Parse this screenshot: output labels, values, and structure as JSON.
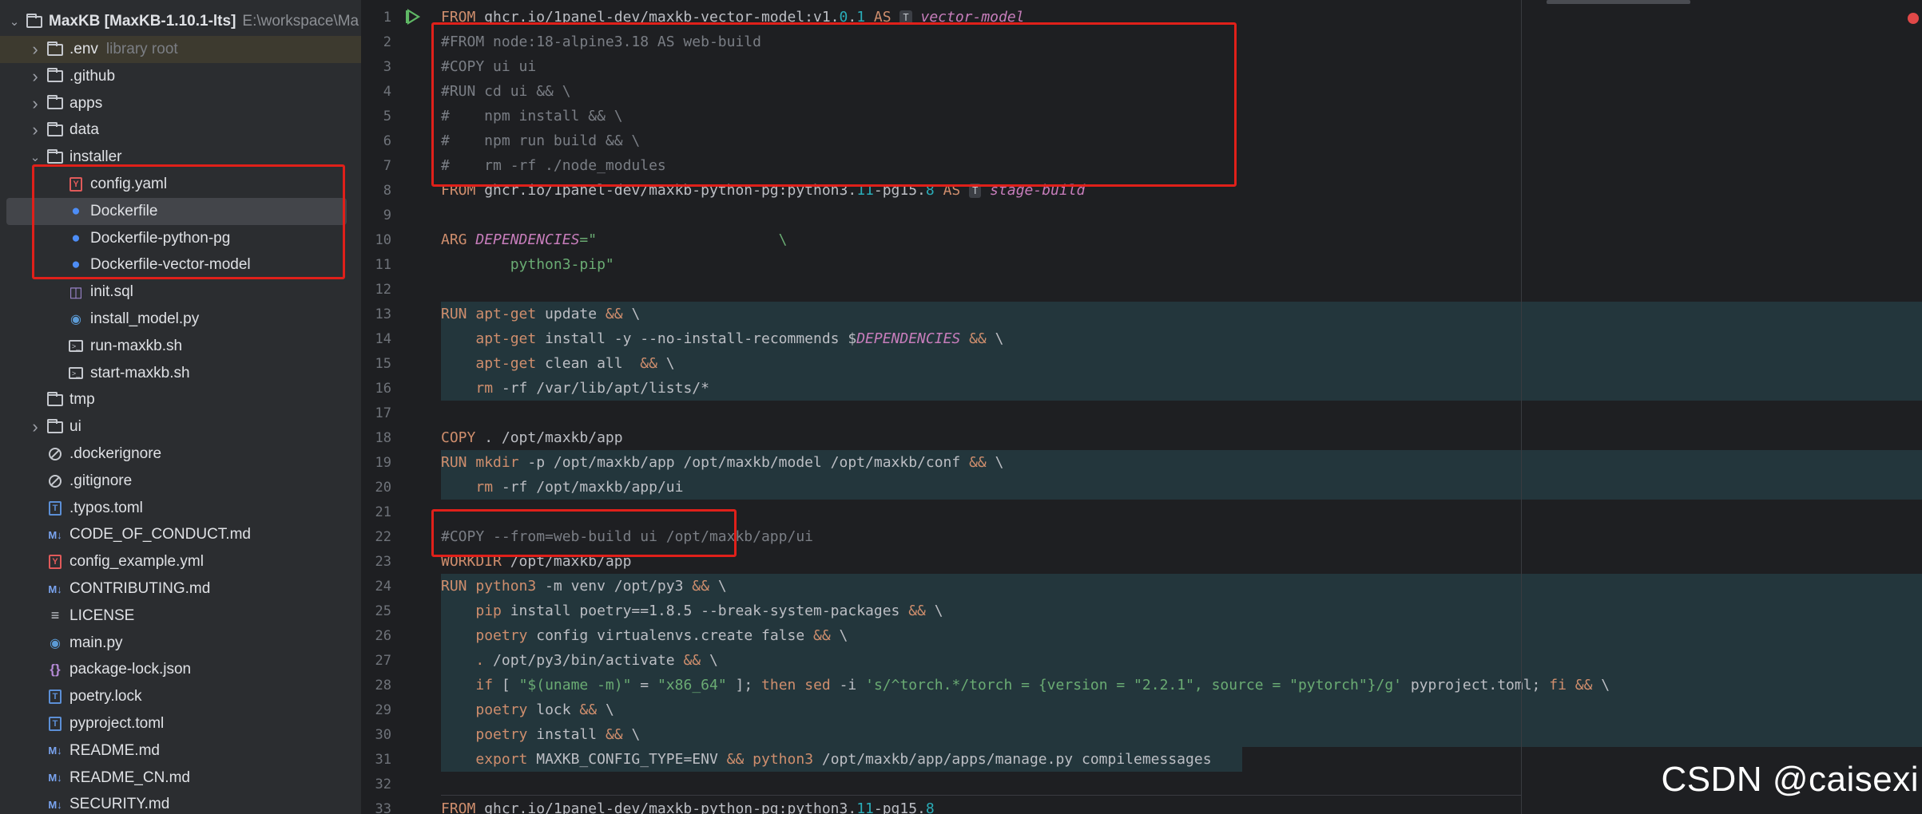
{
  "project_tree": {
    "root": {
      "name": "MaxKB [MaxKB-1.10.1-lts]",
      "path": "E:\\workspace\\Ma"
    },
    "items": [
      {
        "label": ".env",
        "hint": "library root",
        "type": "folder",
        "chevron": "right",
        "indent": 1
      },
      {
        "label": ".github",
        "type": "folder",
        "chevron": "right",
        "indent": 1
      },
      {
        "label": "apps",
        "type": "folder",
        "chevron": "right",
        "indent": 1
      },
      {
        "label": "data",
        "type": "folder",
        "chevron": "right",
        "indent": 1
      },
      {
        "label": "installer",
        "type": "folder",
        "chevron": "down",
        "indent": 1
      },
      {
        "label": "config.yaml",
        "type": "yaml",
        "indent": 2
      },
      {
        "label": "Dockerfile",
        "type": "docker",
        "indent": 2,
        "selected": true
      },
      {
        "label": "Dockerfile-python-pg",
        "type": "docker",
        "indent": 2
      },
      {
        "label": "Dockerfile-vector-model",
        "type": "docker",
        "indent": 2
      },
      {
        "label": "init.sql",
        "type": "sql",
        "indent": 2
      },
      {
        "label": "install_model.py",
        "type": "py",
        "indent": 2
      },
      {
        "label": "run-maxkb.sh",
        "type": "sh",
        "indent": 2
      },
      {
        "label": "start-maxkb.sh",
        "type": "sh",
        "indent": 2
      },
      {
        "label": "tmp",
        "type": "folder",
        "indent": 1
      },
      {
        "label": "ui",
        "type": "folder",
        "chevron": "right",
        "indent": 1
      },
      {
        "label": ".dockerignore",
        "type": "ignore",
        "indent": 1
      },
      {
        "label": ".gitignore",
        "type": "ignore",
        "indent": 1
      },
      {
        "label": ".typos.toml",
        "type": "toml",
        "indent": 1
      },
      {
        "label": "CODE_OF_CONDUCT.md",
        "type": "md",
        "indent": 1
      },
      {
        "label": "config_example.yml",
        "type": "yaml",
        "indent": 1
      },
      {
        "label": "CONTRIBUTING.md",
        "type": "md",
        "indent": 1
      },
      {
        "label": "LICENSE",
        "type": "license",
        "indent": 1
      },
      {
        "label": "main.py",
        "type": "py",
        "indent": 1
      },
      {
        "label": "package-lock.json",
        "type": "json",
        "indent": 1
      },
      {
        "label": "poetry.lock",
        "type": "toml",
        "indent": 1
      },
      {
        "label": "pyproject.toml",
        "type": "toml",
        "indent": 1
      },
      {
        "label": "README.md",
        "type": "md",
        "indent": 1
      },
      {
        "label": "README_CN.md",
        "type": "md",
        "indent": 1
      },
      {
        "label": "SECURITY.md",
        "type": "md",
        "indent": 1
      }
    ]
  },
  "editor": {
    "line_numbers": [
      "1",
      "2",
      "3",
      "4",
      "5",
      "6",
      "7",
      "8",
      "9",
      "10",
      "11",
      "12",
      "13",
      "14",
      "15",
      "16",
      "17",
      "18",
      "19",
      "20",
      "21",
      "22",
      "23",
      "24",
      "25",
      "26",
      "27",
      "28",
      "29",
      "30",
      "31",
      "32",
      "33"
    ],
    "lines": [
      [
        {
          "t": "FROM ",
          "c": "kw"
        },
        {
          "t": "ghcr.io/1panel-dev/maxkb-vector-model:v1.",
          "c": ""
        },
        {
          "t": "0",
          "c": "num"
        },
        {
          "t": ".",
          "c": ""
        },
        {
          "t": "1",
          "c": "num"
        },
        {
          "t": " AS ",
          "c": "kw"
        },
        {
          "t": "T",
          "c": "badge"
        },
        {
          "t": " vector-model",
          "c": "stage"
        }
      ],
      [
        {
          "t": "#FROM node:18-alpine3.18 AS web-build",
          "c": "cm"
        }
      ],
      [
        {
          "t": "#COPY ui ui",
          "c": "cm"
        }
      ],
      [
        {
          "t": "#RUN cd ui && \\",
          "c": "cm"
        }
      ],
      [
        {
          "t": "#    npm install && \\",
          "c": "cm"
        }
      ],
      [
        {
          "t": "#    npm run build && \\",
          "c": "cm"
        }
      ],
      [
        {
          "t": "#    rm -rf ./node_modules",
          "c": "cm"
        }
      ],
      [
        {
          "t": "FROM ",
          "c": "kw"
        },
        {
          "t": "ghcr.io/1panel-dev/maxkb-python-pg:python3.",
          "c": ""
        },
        {
          "t": "11",
          "c": "num"
        },
        {
          "t": "-pg15.",
          "c": ""
        },
        {
          "t": "8",
          "c": "num"
        },
        {
          "t": " AS ",
          "c": "kw"
        },
        {
          "t": "T",
          "c": "badge"
        },
        {
          "t": " stage-build",
          "c": "stage"
        }
      ],
      [],
      [
        {
          "t": "ARG ",
          "c": "kw"
        },
        {
          "t": "DEPENDENCIES",
          "c": "var"
        },
        {
          "t": "=\"                     \\",
          "c": "str"
        }
      ],
      [
        {
          "t": "        python3-pip\"",
          "c": "str"
        }
      ],
      [],
      [
        {
          "t": "RUN ",
          "c": "kw"
        },
        {
          "t": "apt-get",
          "c": "cmd"
        },
        {
          "t": " update ",
          "c": ""
        },
        {
          "t": "&&",
          "c": "kw"
        },
        {
          "t": " \\",
          "c": ""
        }
      ],
      [
        {
          "t": "    ",
          "c": ""
        },
        {
          "t": "apt-get",
          "c": "cmd"
        },
        {
          "t": " install -y --no-install-recommends ",
          "c": ""
        },
        {
          "t": "$",
          "c": ""
        },
        {
          "t": "DEPENDENCIES",
          "c": "var"
        },
        {
          "t": " ",
          "c": ""
        },
        {
          "t": "&&",
          "c": "kw"
        },
        {
          "t": " \\",
          "c": ""
        }
      ],
      [
        {
          "t": "    ",
          "c": ""
        },
        {
          "t": "apt-get",
          "c": "cmd"
        },
        {
          "t": " clean all  ",
          "c": ""
        },
        {
          "t": "&&",
          "c": "kw"
        },
        {
          "t": " \\",
          "c": ""
        }
      ],
      [
        {
          "t": "    ",
          "c": ""
        },
        {
          "t": "rm",
          "c": "cmd"
        },
        {
          "t": " -rf /var/lib/apt/lists/*",
          "c": ""
        }
      ],
      [],
      [
        {
          "t": "COPY ",
          "c": "kw"
        },
        {
          "t": ". /opt/maxkb/app",
          "c": ""
        }
      ],
      [
        {
          "t": "RUN ",
          "c": "kw"
        },
        {
          "t": "mkdir",
          "c": "cmd"
        },
        {
          "t": " -p /opt/maxkb/app /opt/maxkb/model /opt/maxkb/conf ",
          "c": ""
        },
        {
          "t": "&&",
          "c": "kw"
        },
        {
          "t": " \\",
          "c": ""
        }
      ],
      [
        {
          "t": "    ",
          "c": ""
        },
        {
          "t": "rm",
          "c": "cmd"
        },
        {
          "t": " -rf /opt/maxkb/app/ui",
          "c": ""
        }
      ],
      [],
      [
        {
          "t": "#COPY --from=web-build ui /opt/maxkb/app/ui",
          "c": "cm"
        }
      ],
      [
        {
          "t": "WORKDIR ",
          "c": "kw"
        },
        {
          "t": "/opt/maxkb/app",
          "c": ""
        }
      ],
      [
        {
          "t": "RUN ",
          "c": "kw"
        },
        {
          "t": "python3",
          "c": "cmd"
        },
        {
          "t": " -m venv /opt/py3 ",
          "c": ""
        },
        {
          "t": "&&",
          "c": "kw"
        },
        {
          "t": " \\",
          "c": ""
        }
      ],
      [
        {
          "t": "    ",
          "c": ""
        },
        {
          "t": "pip",
          "c": "cmd"
        },
        {
          "t": " install poetry==1.8.5 --break-system-packages ",
          "c": ""
        },
        {
          "t": "&&",
          "c": "kw"
        },
        {
          "t": " \\",
          "c": ""
        }
      ],
      [
        {
          "t": "    ",
          "c": ""
        },
        {
          "t": "poetry",
          "c": "cmd"
        },
        {
          "t": " config virtualenvs.create false ",
          "c": ""
        },
        {
          "t": "&&",
          "c": "kw"
        },
        {
          "t": " \\",
          "c": ""
        }
      ],
      [
        {
          "t": "    ",
          "c": ""
        },
        {
          "t": ".",
          "c": "cmd"
        },
        {
          "t": " /opt/py3/bin/activate ",
          "c": ""
        },
        {
          "t": "&&",
          "c": "kw"
        },
        {
          "t": " \\",
          "c": ""
        }
      ],
      [
        {
          "t": "    ",
          "c": ""
        },
        {
          "t": "if",
          "c": "kw"
        },
        {
          "t": " [ ",
          "c": ""
        },
        {
          "t": "\"$(uname -m)\"",
          "c": "str"
        },
        {
          "t": " = ",
          "c": ""
        },
        {
          "t": "\"x86_64\"",
          "c": "str"
        },
        {
          "t": " ]; ",
          "c": ""
        },
        {
          "t": "then",
          "c": "kw"
        },
        {
          "t": " ",
          "c": ""
        },
        {
          "t": "sed",
          "c": "cmd"
        },
        {
          "t": " -i ",
          "c": ""
        },
        {
          "t": "'s/^torch.*/torch = {version = \"2.2.1\", source = \"pytorch\"}/g'",
          "c": "str"
        },
        {
          "t": " pyproject.toml; ",
          "c": ""
        },
        {
          "t": "fi",
          "c": "kw"
        },
        {
          "t": " ",
          "c": ""
        },
        {
          "t": "&&",
          "c": "kw"
        },
        {
          "t": " \\",
          "c": ""
        }
      ],
      [
        {
          "t": "    ",
          "c": ""
        },
        {
          "t": "poetry",
          "c": "cmd"
        },
        {
          "t": " lock ",
          "c": ""
        },
        {
          "t": "&&",
          "c": "kw"
        },
        {
          "t": " \\",
          "c": ""
        }
      ],
      [
        {
          "t": "    ",
          "c": ""
        },
        {
          "t": "poetry",
          "c": "cmd"
        },
        {
          "t": " install ",
          "c": ""
        },
        {
          "t": "&&",
          "c": "kw"
        },
        {
          "t": " \\",
          "c": ""
        }
      ],
      [
        {
          "t": "    ",
          "c": ""
        },
        {
          "t": "export",
          "c": "kw"
        },
        {
          "t": " MAXKB_CONFIG_TYPE=ENV ",
          "c": ""
        },
        {
          "t": "&&",
          "c": "kw"
        },
        {
          "t": " ",
          "c": ""
        },
        {
          "t": "python3",
          "c": "cmd"
        },
        {
          "t": " /opt/maxkb/app/apps/manage.py compilemessages",
          "c": ""
        }
      ],
      [],
      [
        {
          "t": "FROM ",
          "c": "kw"
        },
        {
          "t": "ghcr.io/1panel-dev/maxkb-python-pg:python3.",
          "c": ""
        },
        {
          "t": "11",
          "c": "num"
        },
        {
          "t": "-pg15.",
          "c": ""
        },
        {
          "t": "8",
          "c": "num"
        }
      ]
    ],
    "highlighted_lines": [
      13,
      14,
      15,
      16,
      19,
      20,
      24,
      25,
      26,
      27,
      28,
      29,
      30,
      31
    ]
  },
  "watermark": "CSDN @caisexi",
  "colors": {
    "annotation_box": "#e0201a",
    "accent": "#4d8df6"
  }
}
